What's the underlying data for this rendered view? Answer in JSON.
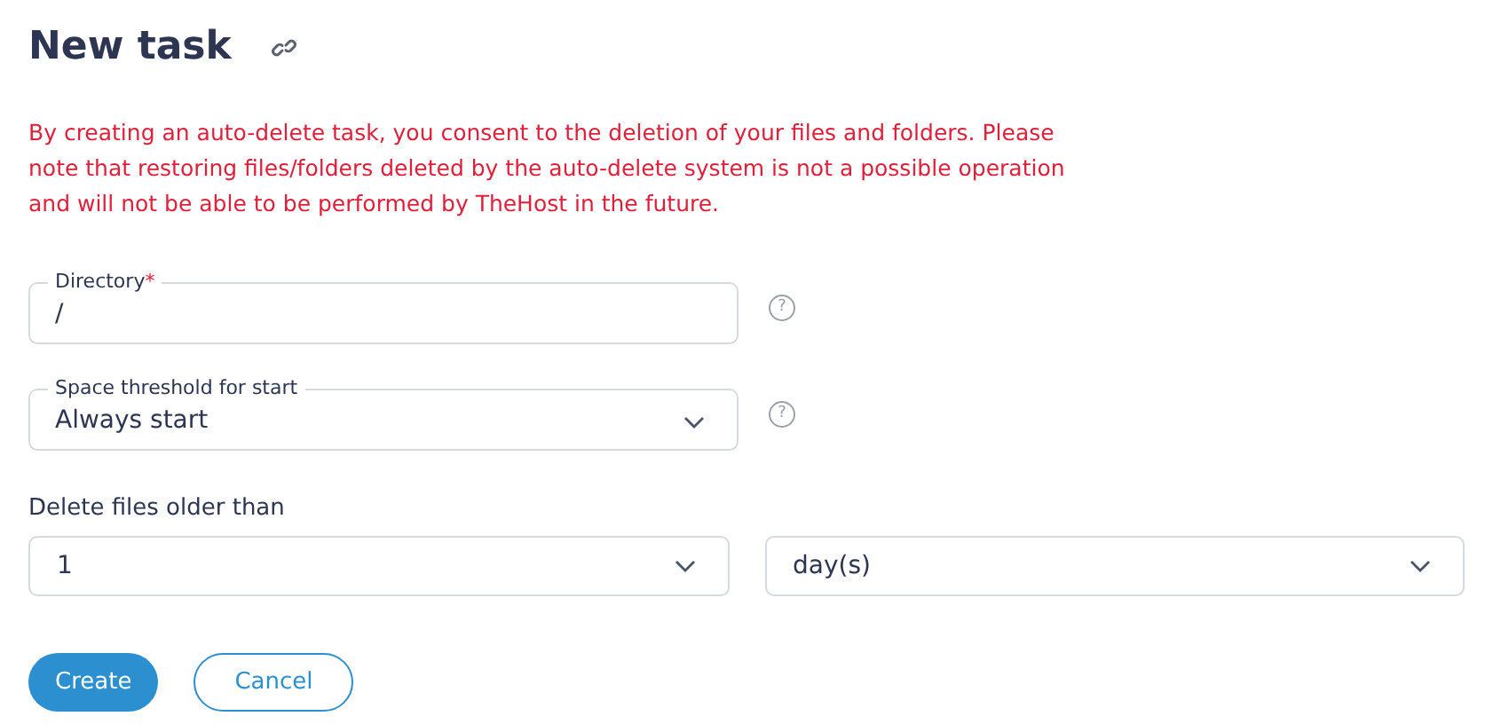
{
  "title": "New task",
  "warning": "By creating an auto-delete task, you consent to the deletion of your files and folders. Please note that restoring files/folders deleted by the auto-delete system is not a possible operation and will not be able to be performed by TheHost in the future.",
  "fields": [
    {
      "kind": "input",
      "label": "Directory",
      "required_mark": "*",
      "value": "/",
      "help": "?"
    },
    {
      "kind": "select",
      "label": "Space threshold for start",
      "value": "Always start",
      "help": "?"
    }
  ],
  "age": {
    "label": "Delete files older than",
    "amount": "1",
    "unit": "day(s)"
  },
  "buttons": [
    {
      "kind": "primary",
      "label": "Create"
    },
    {
      "kind": "secondary",
      "label": "Cancel"
    }
  ]
}
